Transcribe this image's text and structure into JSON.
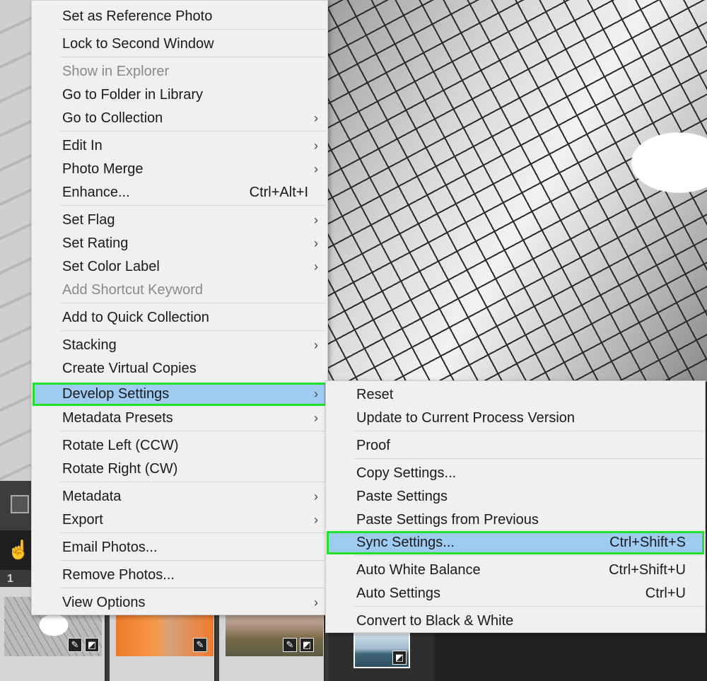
{
  "context_menu": {
    "items": [
      {
        "label": "Set as Reference Photo"
      },
      {
        "label": "Lock to Second Window"
      },
      {
        "label": "Show in Explorer",
        "disabled": true
      },
      {
        "label": "Go to Folder in Library"
      },
      {
        "label": "Go to Collection",
        "submenu": true
      },
      {
        "label": "Edit In",
        "submenu": true
      },
      {
        "label": "Photo Merge",
        "submenu": true
      },
      {
        "label": "Enhance...",
        "shortcut": "Ctrl+Alt+I"
      },
      {
        "label": "Set Flag",
        "submenu": true
      },
      {
        "label": "Set Rating",
        "submenu": true
      },
      {
        "label": "Set Color Label",
        "submenu": true
      },
      {
        "label": "Add Shortcut Keyword",
        "disabled": true
      },
      {
        "label": "Add to Quick Collection"
      },
      {
        "label": "Stacking",
        "submenu": true
      },
      {
        "label": "Create Virtual Copies"
      },
      {
        "label": "Develop Settings",
        "submenu": true,
        "highlighted": true
      },
      {
        "label": "Metadata Presets",
        "submenu": true
      },
      {
        "label": "Rotate Left (CCW)"
      },
      {
        "label": "Rotate Right (CW)"
      },
      {
        "label": "Metadata",
        "submenu": true
      },
      {
        "label": "Export",
        "submenu": true
      },
      {
        "label": "Email Photos..."
      },
      {
        "label": "Remove Photos..."
      },
      {
        "label": "View Options",
        "submenu": true
      }
    ],
    "arrow": "›"
  },
  "develop_submenu": {
    "items": [
      {
        "label": "Reset"
      },
      {
        "label": "Update to Current Process Version"
      },
      {
        "label": "Proof"
      },
      {
        "label": "Copy Settings..."
      },
      {
        "label": "Paste Settings"
      },
      {
        "label": "Paste Settings from Previous"
      },
      {
        "label": "Sync Settings...",
        "shortcut": "Ctrl+Shift+S",
        "highlighted": true
      },
      {
        "label": "Auto White Balance",
        "shortcut": "Ctrl+Shift+U"
      },
      {
        "label": "Auto Settings",
        "shortcut": "Ctrl+U"
      },
      {
        "label": "Convert to Black & White"
      }
    ]
  },
  "filmstrip": {
    "count_label": "1"
  },
  "colors": {
    "highlight_fill": "#9ecbf2",
    "highlight_outline": "#22e12a",
    "menu_bg": "#f0f0f0"
  },
  "icons": {
    "hand": "hand-tool-icon",
    "badge": "edit-badge-icon"
  }
}
